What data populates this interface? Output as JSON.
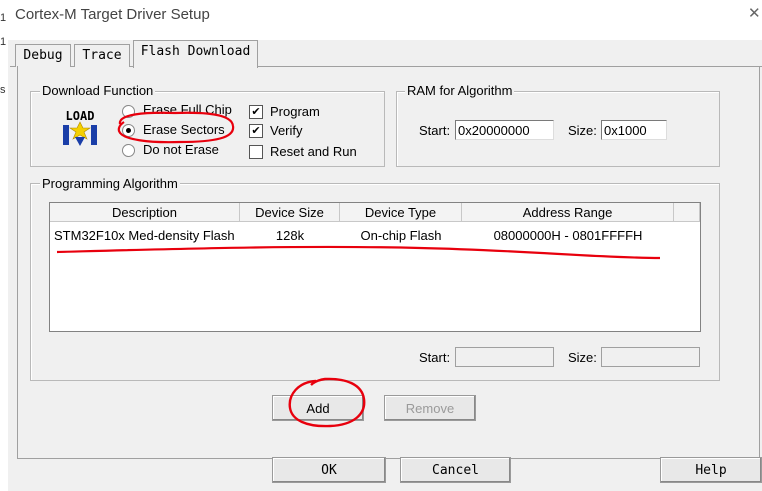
{
  "window": {
    "title": "Cortex-M Target Driver Setup",
    "left_fragments": [
      "1",
      "1",
      "s"
    ]
  },
  "tabs": [
    "Debug",
    "Trace",
    "Flash Download"
  ],
  "download_function": {
    "label": "Download Function",
    "load_icon_text": "LOAD",
    "radios": [
      {
        "label": "Erase Full Chip",
        "selected": false
      },
      {
        "label": "Erase Sectors",
        "selected": true
      },
      {
        "label": "Do not Erase",
        "selected": false
      }
    ],
    "checks": [
      {
        "label": "Program",
        "checked": true
      },
      {
        "label": "Verify",
        "checked": true
      },
      {
        "label": "Reset and Run",
        "checked": false
      }
    ]
  },
  "ram": {
    "label": "RAM for Algorithm",
    "start_label": "Start:",
    "start_value": "0x20000000",
    "size_label": "Size:",
    "size_value": "0x1000"
  },
  "programming": {
    "label": "Programming Algorithm",
    "columns": [
      "Description",
      "Device Size",
      "Device Type",
      "Address Range"
    ],
    "rows": [
      {
        "description": "STM32F10x Med-density Flash",
        "size": "128k",
        "type": "On-chip Flash",
        "range": "08000000H - 0801FFFFH"
      }
    ],
    "start_label": "Start:",
    "start_value": "",
    "size_label": "Size:",
    "size_value": ""
  },
  "buttons": {
    "add": "Add",
    "remove": "Remove",
    "ok": "OK",
    "cancel": "Cancel",
    "help": "Help"
  },
  "colors": {
    "annotation": "#e8000d",
    "dialog_bg": "#f0f0f0",
    "load_arrow": "#1a3ea8",
    "load_star": "#f4d000"
  }
}
